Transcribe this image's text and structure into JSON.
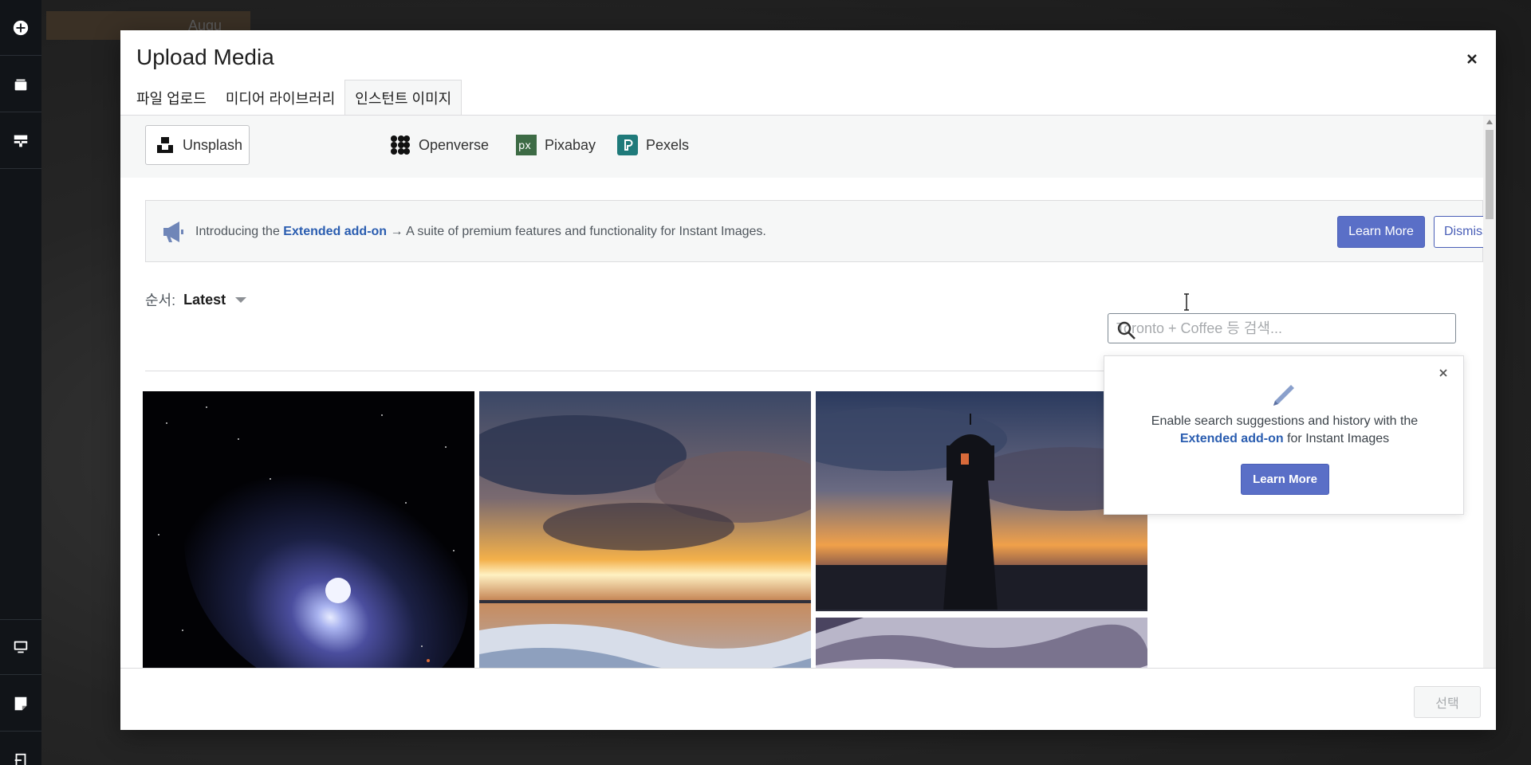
{
  "background": {
    "block_text": "Augu"
  },
  "sidebar": {
    "icons": [
      "plus-circle-icon",
      "layers-icon",
      "block-icon",
      "desktop-icon",
      "note-icon",
      "exit-icon"
    ]
  },
  "modal": {
    "title": "Upload Media",
    "tabs": [
      {
        "label": "파일 업로드"
      },
      {
        "label": "미디어 라이브러리"
      },
      {
        "label": "인스턴트 이미지",
        "active": true
      }
    ]
  },
  "providers": [
    {
      "label": "Unsplash",
      "active": true
    },
    {
      "label": "Openverse"
    },
    {
      "label": "Pixabay"
    },
    {
      "label": "Pexels"
    }
  ],
  "notice": {
    "intro": "Introducing the ",
    "link": "Extended add-on",
    "rest": " → A suite of premium features and functionality for Instant Images.",
    "learn_more": "Learn More",
    "dismiss": "Dismiss"
  },
  "sort": {
    "label": "순서:",
    "value": "Latest"
  },
  "search": {
    "placeholder": "Toronto + Coffee 등 검색...",
    "value": ""
  },
  "popover": {
    "line1": "Enable search suggestions and history with the",
    "link": "Extended add-on",
    "line2_rest": " for Instant Images",
    "button": "Learn More"
  },
  "photos": [
    "comet-photo",
    "ocean-sunset-photo",
    "lighthouse-photo",
    "mountain-photo"
  ],
  "footer": {
    "select_label": "선택"
  },
  "colors": {
    "primary": "#5a6fc7",
    "link": "#2a5db0",
    "sidebar": "#111418"
  }
}
